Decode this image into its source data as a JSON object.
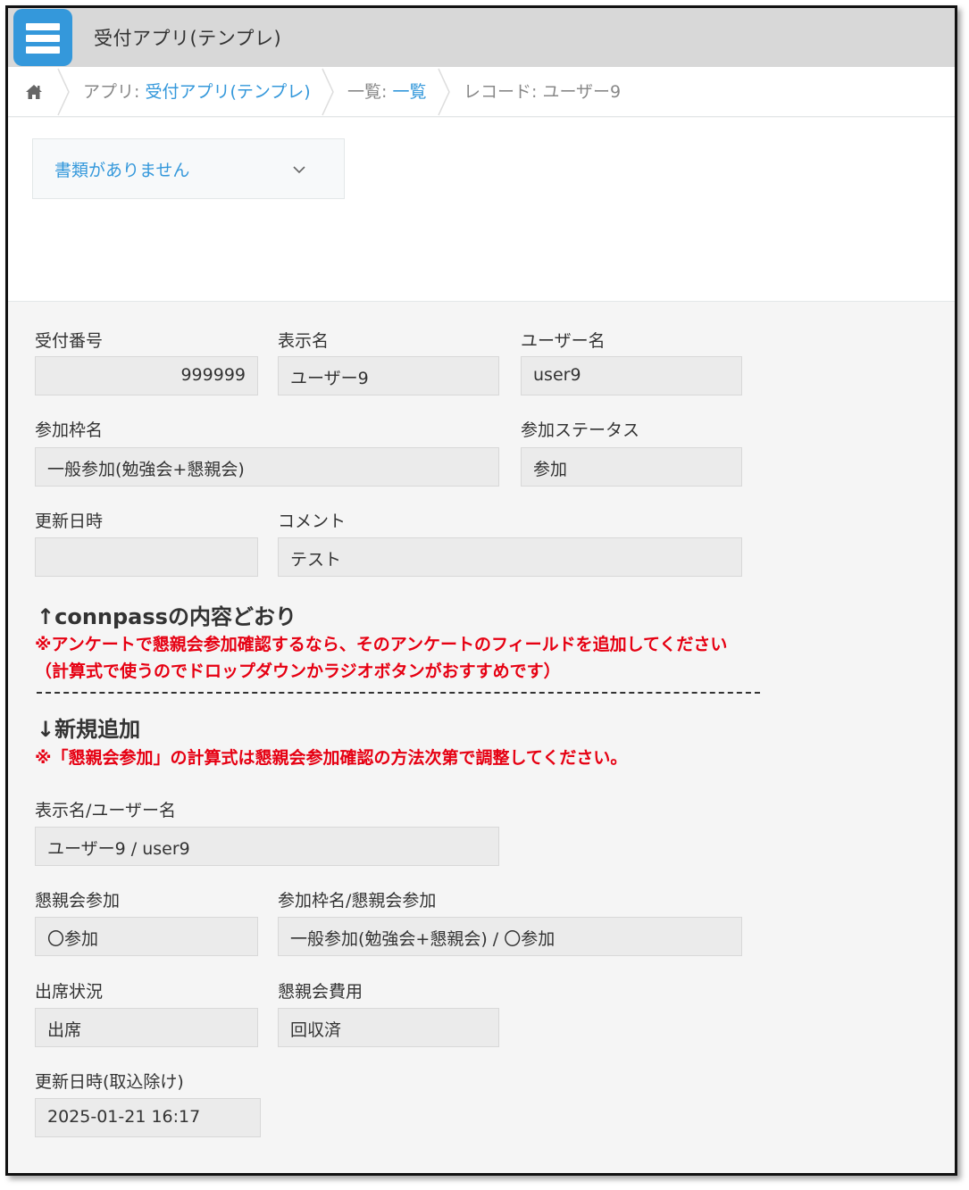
{
  "app": {
    "title": "受付アプリ(テンプレ)"
  },
  "breadcrumb": {
    "app_prefix": "アプリ: ",
    "app_link": "受付アプリ(テンプレ)",
    "list_prefix": "一覧: ",
    "list_link": "一覧",
    "record": "レコード: ユーザー9"
  },
  "documents": {
    "selected": "書類がありません"
  },
  "fields": {
    "reception_no": {
      "label": "受付番号",
      "value": "999999"
    },
    "display_name": {
      "label": "表示名",
      "value": "ユーザー9"
    },
    "user_name": {
      "label": "ユーザー名",
      "value": "user9"
    },
    "frame_name": {
      "label": "参加枠名",
      "value": "一般参加(勉強会+懇親会)"
    },
    "status": {
      "label": "参加ステータス",
      "value": "参加"
    },
    "updated_at": {
      "label": "更新日時",
      "value": ""
    },
    "comment": {
      "label": "コメント",
      "value": "テスト"
    },
    "display_user": {
      "label": "表示名/ユーザー名",
      "value": "ユーザー9 / user9"
    },
    "party": {
      "label": "懇親会参加",
      "value": "〇参加"
    },
    "frame_party": {
      "label": "参加枠名/懇親会参加",
      "value": "一般参加(勉強会+懇親会) / 〇参加"
    },
    "attendance": {
      "label": "出席状況",
      "value": "出席"
    },
    "party_fee": {
      "label": "懇親会費用",
      "value": "回収済"
    },
    "updated_import": {
      "label": "更新日時(取込除け)",
      "value": "2025-01-21 16:17"
    }
  },
  "notes": {
    "connpass_heading": "↑connpassの内容どおり",
    "connpass_note_1": "※アンケートで懇親会参加確認するなら、そのアンケートのフィールドを追加してください",
    "connpass_note_2": "（計算式で使うのでドロップダウンかラジオボタンがおすすめです）",
    "new_heading": "↓新規追加",
    "new_note": "※「懇親会参加」の計算式は懇親会参加確認の方法次第で調整してください。"
  },
  "colors": {
    "accent": "#3498db",
    "warning": "#e60012",
    "header_bg": "#d8d8d8",
    "field_bg": "#ebebeb"
  },
  "icons": [
    "app-list-icon",
    "home-icon",
    "chevron-right-icon",
    "chevron-down-icon"
  ]
}
